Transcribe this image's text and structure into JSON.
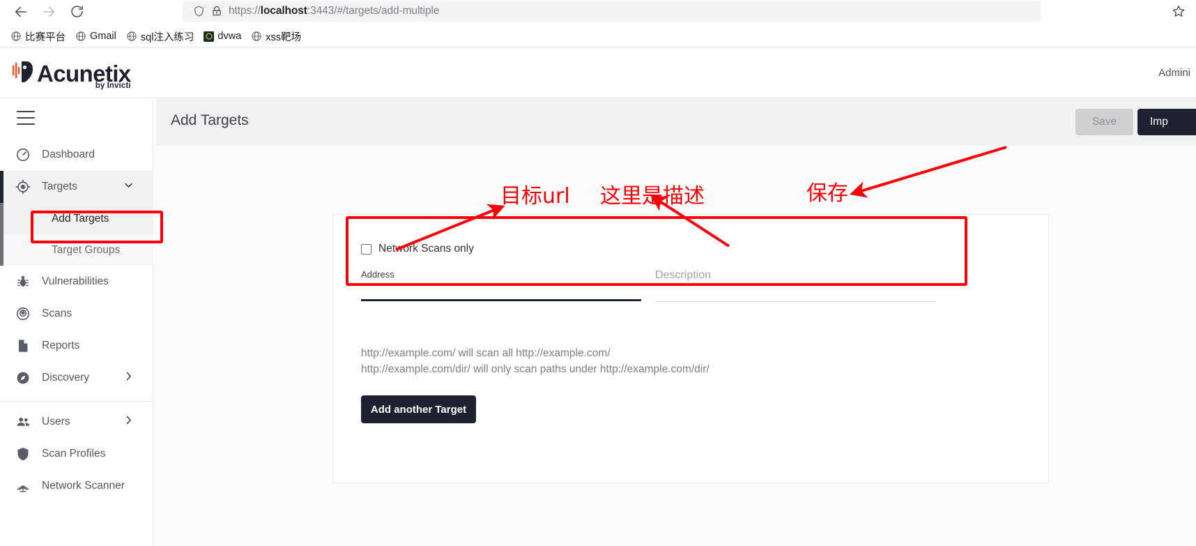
{
  "browser": {
    "back_icon": "arrow-left-icon",
    "forward_icon": "arrow-right-icon",
    "reload_icon": "reload-icon",
    "shield_icon": "shield-icon",
    "lock_warning_icon": "lock-warning-icon",
    "star_icon": "star-icon",
    "url_scheme": "https://",
    "url_host": "localhost",
    "url_rest": ":3443/#/targets/add-multiple",
    "url_full": "https://localhost:3443/#/targets/add-multiple",
    "bookmarks": [
      {
        "label": "比赛平台",
        "icon": "globe-icon"
      },
      {
        "label": "Gmail",
        "icon": "globe-icon"
      },
      {
        "label": "sql注入练习",
        "icon": "globe-icon"
      },
      {
        "label": "dvwa",
        "icon": "dvwa-favicon"
      },
      {
        "label": "xss靶场",
        "icon": "globe-icon"
      }
    ]
  },
  "app": {
    "logo_word": "Acunetix",
    "logo_sub": "by Invicti",
    "account": "Admini",
    "hamburger_icon": "hamburger-menu-icon"
  },
  "sidebar": {
    "items": [
      {
        "label": "Dashboard",
        "icon": "dashboard-gauge-icon",
        "expandable": false,
        "active": false
      },
      {
        "label": "Targets",
        "icon": "target-crosshair-icon",
        "expandable": true,
        "active": true
      },
      {
        "label": "Vulnerabilities",
        "icon": "bug-icon",
        "expandable": false,
        "active": false
      },
      {
        "label": "Scans",
        "icon": "radar-scan-icon",
        "expandable": false,
        "active": false
      },
      {
        "label": "Reports",
        "icon": "document-icon",
        "expandable": false,
        "active": false
      },
      {
        "label": "Discovery",
        "icon": "compass-icon",
        "expandable": true,
        "active": false
      },
      {
        "label": "Users",
        "icon": "users-icon",
        "expandable": true,
        "active": false
      },
      {
        "label": "Scan Profiles",
        "icon": "shield-icon",
        "expandable": false,
        "active": false
      },
      {
        "label": "Network Scanner",
        "icon": "network-scanner-icon",
        "expandable": false,
        "active": false
      }
    ],
    "sub_items": [
      {
        "label": "Add Targets",
        "selected": true
      },
      {
        "label": "Target Groups",
        "selected": false
      }
    ]
  },
  "page": {
    "title": "Add Targets",
    "save_label": "Save",
    "save_disabled": true,
    "import_label": "Imp"
  },
  "form": {
    "network_scans_only_label": "Network Scans only",
    "network_scans_only_checked": false,
    "address_label": "Address",
    "address_value": "",
    "description_label": "Description",
    "description_value": "",
    "hint_line1": "http://example.com/ will scan all http://example.com/",
    "hint_line2": "http://example.com/dir/ will only scan paths under http://example.com/dir/",
    "add_another_label": "Add another Target"
  },
  "annotations": {
    "color": "#fb0007",
    "url_note": "目标url",
    "description_note": "这里是描述",
    "save_note": "保存"
  }
}
